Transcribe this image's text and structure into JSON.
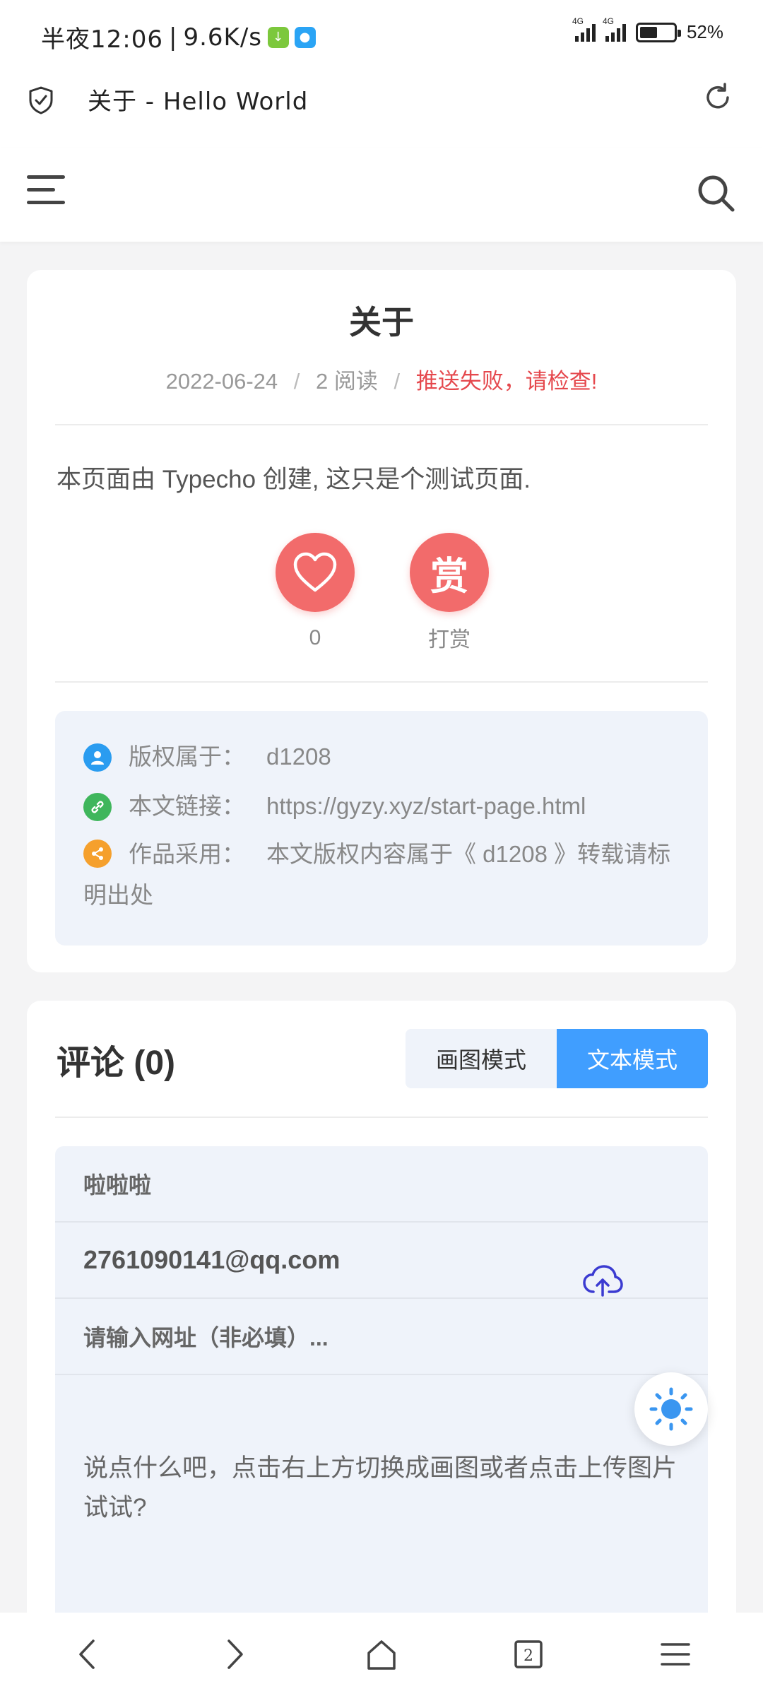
{
  "status_bar": {
    "time": "半夜12:06",
    "speed": "9.6K/s",
    "net1": "4G",
    "net2": "4G",
    "battery": "52%"
  },
  "browser": {
    "title": "关于 - Hello World",
    "shield_icon": "shield-check-icon",
    "reload_icon": "reload-icon"
  },
  "header": {
    "menu_icon": "hamburger-menu-icon",
    "search_icon": "search-icon"
  },
  "post": {
    "title": "关于",
    "date": "2022-06-24",
    "sep": "/",
    "reads": "2 阅读",
    "push_status": "推送失败，请检查!",
    "body": "本页面由 Typecho 创建, 这只是个测试页面.",
    "like_count": "0",
    "reward_glyph": "赏",
    "reward_label": "打赏"
  },
  "copyright": {
    "owner_key": "版权属于：",
    "owner_value": "d1208",
    "link_key": "本文链接：",
    "link_value": "https://gyzy.xyz/start-page.html",
    "license_key": "作品采用：",
    "license_value": "本文版权内容属于《 d1208 》转载请标明出处"
  },
  "comments": {
    "title": "评论 (0)",
    "mode_draw": "画图模式",
    "mode_text": "文本模式",
    "name_value": "啦啦啦",
    "email_value": "2761090141@qq.com",
    "url_placeholder": "请输入网址（非必填）...",
    "content_placeholder": "说点什么吧，点击右上方切换成画图或者点击上传图片试试?"
  },
  "nav": {
    "back": "back-icon",
    "forward": "forward-icon",
    "home": "home-icon",
    "tabs_count": "2",
    "menu": "menu-icon"
  },
  "colors": {
    "accent": "#409eff",
    "like": "#f26b6b",
    "warning": "#e5484d"
  }
}
